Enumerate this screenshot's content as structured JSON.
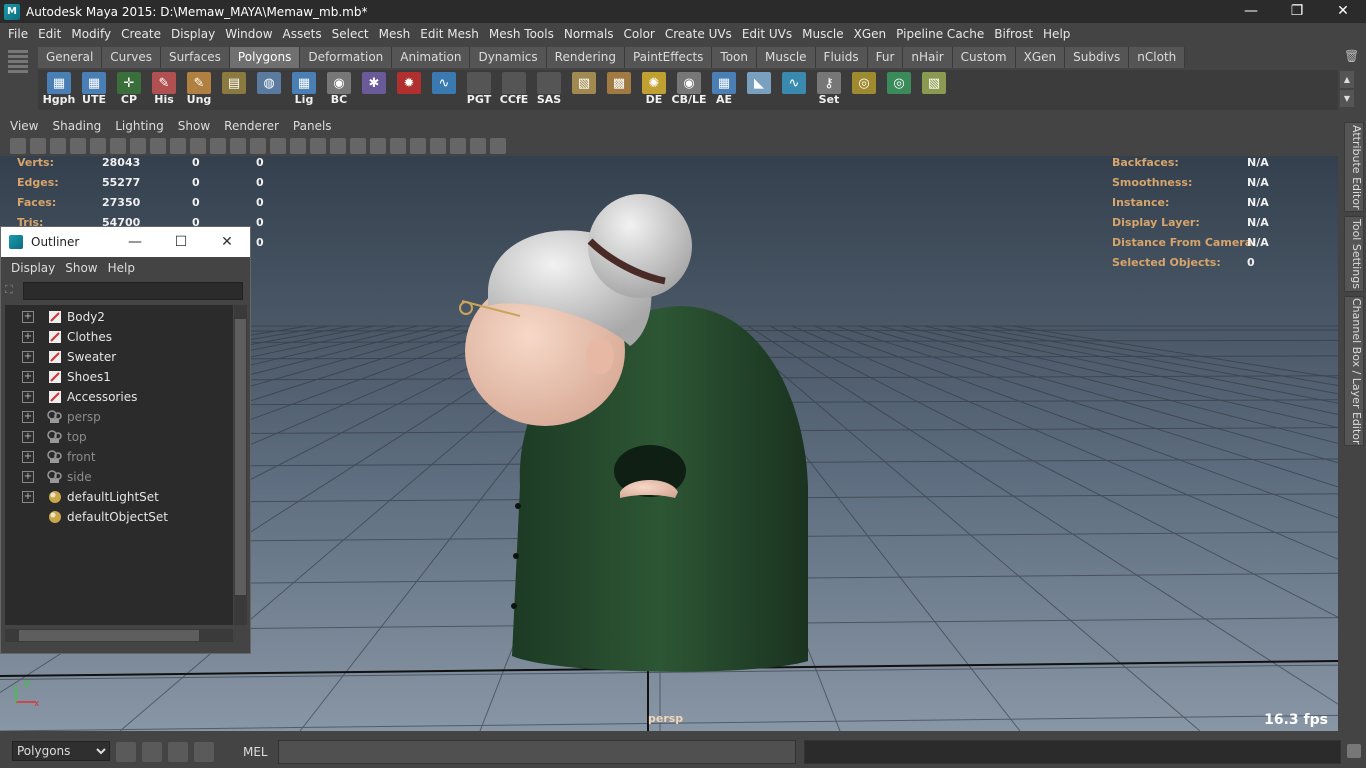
{
  "window": {
    "title": "Autodesk Maya 2015: D:\\Memaw_MAYA\\Memaw_mb.mb*",
    "minimize": "—",
    "maximize": "❐",
    "close": "✕"
  },
  "menubar": [
    "File",
    "Edit",
    "Modify",
    "Create",
    "Display",
    "Window",
    "Assets",
    "Select",
    "Mesh",
    "Edit Mesh",
    "Mesh Tools",
    "Normals",
    "Color",
    "Create UVs",
    "Edit UVs",
    "Muscle",
    "XGen",
    "Pipeline Cache",
    "Bifrost",
    "Help"
  ],
  "shelf": {
    "tabs": [
      "General",
      "Curves",
      "Surfaces",
      "Polygons",
      "Deformation",
      "Animation",
      "Dynamics",
      "Rendering",
      "PaintEffects",
      "Toon",
      "Muscle",
      "Fluids",
      "Fur",
      "nHair",
      "Custom",
      "XGen",
      "Subdivs",
      "nCloth"
    ],
    "active_tab": "Polygons",
    "buttons": [
      {
        "label": "Hgph",
        "icon": "hypergraph-icon",
        "color": "#4a7fb5"
      },
      {
        "label": "UTE",
        "icon": "uv-editor-icon",
        "color": "#4a7fb5"
      },
      {
        "label": "CP",
        "icon": "center-pivot-icon",
        "color": "#3a6e3a"
      },
      {
        "label": "His",
        "icon": "delete-history-icon",
        "color": "#b05050"
      },
      {
        "label": "Ung",
        "icon": "ungroup-icon",
        "color": "#b08040"
      },
      {
        "label": "",
        "icon": "stack-icon",
        "color": "#8a7a40"
      },
      {
        "label": "",
        "icon": "world-icon",
        "color": "#5a7aa0"
      },
      {
        "label": "Lig",
        "icon": "light-editor-icon",
        "color": "#4a7fb5"
      },
      {
        "label": "BC",
        "icon": "eye-icon",
        "color": "#777777"
      },
      {
        "label": "",
        "icon": "joint-icon",
        "color": "#6a5a9a"
      },
      {
        "label": "",
        "icon": "gear-icon",
        "color": "#b03030"
      },
      {
        "label": "",
        "icon": "curve-icon",
        "color": "#3a7ab0"
      },
      {
        "label": "PGT",
        "icon": "script-icon",
        "color": "#555555"
      },
      {
        "label": "CCfE",
        "icon": "script-icon",
        "color": "#555555"
      },
      {
        "label": "SAS",
        "icon": "script-icon",
        "color": "#555555"
      },
      {
        "label": "",
        "icon": "texture-icon",
        "color": "#a08a50"
      },
      {
        "label": "",
        "icon": "texture-grid-icon",
        "color": "#a07a40"
      },
      {
        "label": "DE",
        "icon": "light-bulb-icon",
        "color": "#c0a030"
      },
      {
        "label": "CB/LE",
        "icon": "eye-icon",
        "color": "#777777"
      },
      {
        "label": "AE",
        "icon": "attribute-editor-icon",
        "color": "#4a7fb5"
      },
      {
        "label": "",
        "icon": "spotlight-icon",
        "color": "#7aa0c0"
      },
      {
        "label": "",
        "icon": "curve-icon",
        "color": "#3a8ab0"
      },
      {
        "label": "Set",
        "icon": "key-icon",
        "color": "#777777"
      },
      {
        "label": "",
        "icon": "target-icon",
        "color": "#a08a30"
      },
      {
        "label": "",
        "icon": "target-icon",
        "color": "#3a8a5a"
      },
      {
        "label": "",
        "icon": "texture-icon",
        "color": "#8a9a50"
      }
    ]
  },
  "panel_menu": [
    "View",
    "Shading",
    "Lighting",
    "Show",
    "Renderer",
    "Panels"
  ],
  "hud_left": [
    {
      "label": "Verts:",
      "a": "28043",
      "b": "0",
      "c": "0"
    },
    {
      "label": "Edges:",
      "a": "55277",
      "b": "0",
      "c": "0"
    },
    {
      "label": "Faces:",
      "a": "27350",
      "b": "0",
      "c": "0"
    },
    {
      "label": "Tris:",
      "a": "54700",
      "b": "0",
      "c": "0"
    },
    {
      "label": "",
      "a": "",
      "b": "",
      "c": "0"
    }
  ],
  "hud_right": [
    {
      "label": "Backfaces:",
      "value": "N/A"
    },
    {
      "label": "Smoothness:",
      "value": "N/A"
    },
    {
      "label": "Instance:",
      "value": "N/A"
    },
    {
      "label": "Display Layer:",
      "value": "N/A"
    },
    {
      "label": "Distance From Camera:",
      "value": "N/A"
    },
    {
      "label": "Selected Objects:",
      "value": "0"
    }
  ],
  "viewport": {
    "camera": "persp",
    "fps": "16.3 fps",
    "axis_y": "y",
    "axis_x": "x"
  },
  "right_tabs": [
    "Attribute Editor",
    "Tool Settings",
    "Channel Box / Layer Editor"
  ],
  "outliner": {
    "title": "Outliner",
    "menu": [
      "Display",
      "Show",
      "Help"
    ],
    "filter_placeholder": "",
    "items": [
      {
        "name": "Body2",
        "type": "transform",
        "expandable": true
      },
      {
        "name": "Clothes",
        "type": "transform",
        "expandable": true
      },
      {
        "name": "Sweater",
        "type": "transform",
        "expandable": true
      },
      {
        "name": "Shoes1",
        "type": "transform",
        "expandable": true
      },
      {
        "name": "Accessories",
        "type": "transform",
        "expandable": true
      },
      {
        "name": "persp",
        "type": "camera",
        "expandable": true
      },
      {
        "name": "top",
        "type": "camera",
        "expandable": true
      },
      {
        "name": "front",
        "type": "camera",
        "expandable": true
      },
      {
        "name": "side",
        "type": "camera",
        "expandable": true
      },
      {
        "name": "defaultLightSet",
        "type": "set",
        "expandable": true
      },
      {
        "name": "defaultObjectSet",
        "type": "set",
        "expandable": false
      }
    ]
  },
  "command_line": {
    "mode": "Polygons",
    "language": "MEL",
    "input": "",
    "result": ""
  }
}
